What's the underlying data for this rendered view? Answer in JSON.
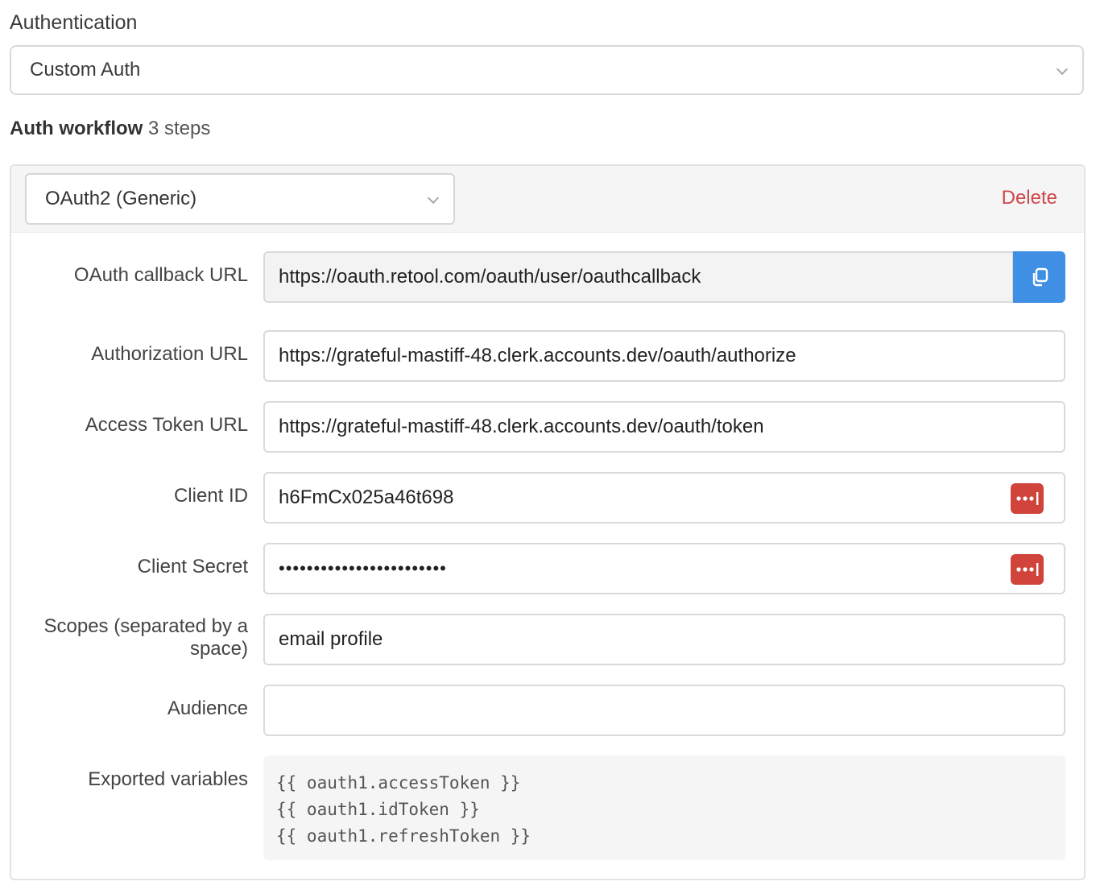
{
  "authentication": {
    "label": "Authentication",
    "selected": "Custom Auth"
  },
  "workflow": {
    "title": "Auth workflow",
    "steps": "3 steps"
  },
  "step": {
    "type": "OAuth2 (Generic)",
    "delete_label": "Delete",
    "fields": {
      "callback_url": {
        "label": "OAuth callback URL",
        "value": "https://oauth.retool.com/oauth/user/oauthcallback"
      },
      "authorization_url": {
        "label": "Authorization URL",
        "value": "https://grateful-mastiff-48.clerk.accounts.dev/oauth/authorize"
      },
      "access_token_url": {
        "label": "Access Token URL",
        "value": "https://grateful-mastiff-48.clerk.accounts.dev/oauth/token"
      },
      "client_id": {
        "label": "Client ID",
        "value": "h6FmCx025a46t698"
      },
      "client_secret": {
        "label": "Client Secret",
        "value": "••••••••••••••••••••••••"
      },
      "scopes": {
        "label_line1": "Scopes (separated by a",
        "label_line2": "space)",
        "value": "email profile"
      },
      "audience": {
        "label": "Audience",
        "value": ""
      }
    },
    "exported": {
      "label": "Exported variables",
      "lines": [
        "{{ oauth1.accessToken }}",
        "{{ oauth1.idToken }}",
        "{{ oauth1.refreshToken }}"
      ]
    }
  },
  "colors": {
    "accent_blue": "#3f8fe4",
    "delete_red": "#d0454c",
    "password_manager_red": "#d0443c"
  },
  "icons": {
    "copy": "copy-icon",
    "chevron": "chevron-down-icon",
    "password_manager": "password-manager-icon"
  }
}
